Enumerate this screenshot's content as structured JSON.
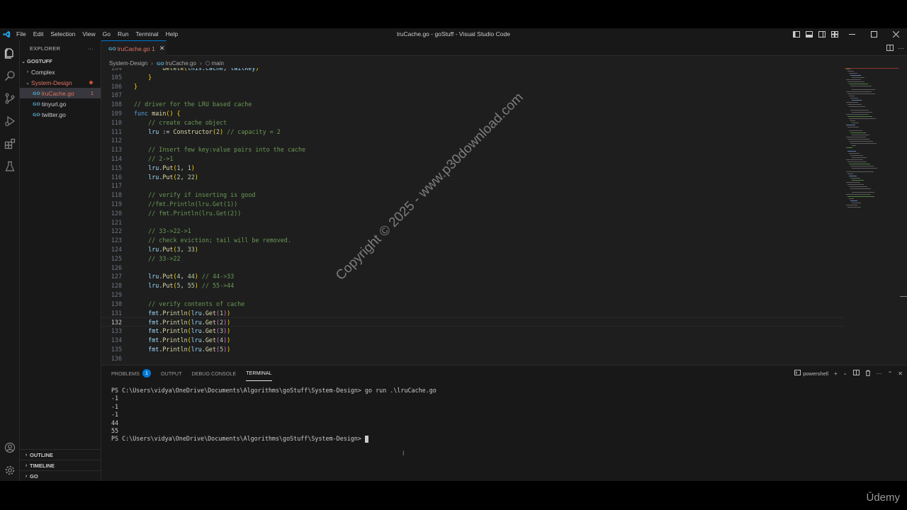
{
  "window": {
    "title": "lruCache.go - goStuff - Visual Studio Code"
  },
  "menu": [
    "File",
    "Edit",
    "Selection",
    "View",
    "Go",
    "Run",
    "Terminal",
    "Help"
  ],
  "sidebar": {
    "title": "EXPLORER",
    "more": "···",
    "root": "GOSTUFF",
    "items": [
      {
        "label": "Complex",
        "type": "folder"
      },
      {
        "label": "System-Design",
        "type": "folder"
      },
      {
        "label": "lruCache.go",
        "type": "file",
        "badge": "1"
      },
      {
        "label": "tinyurl.go",
        "type": "file"
      },
      {
        "label": "twitter.go",
        "type": "file"
      }
    ],
    "bottom": [
      "OUTLINE",
      "TIMELINE",
      "GO"
    ]
  },
  "editor": {
    "tab": {
      "icon": "GO",
      "label": "lruCache.go",
      "badge": "1"
    },
    "breadcrumb": [
      "System-Design",
      "lruCache.go",
      "main"
    ],
    "lines": [
      {
        "n": "104",
        "text": "        delete(this.cache, tailKey)"
      },
      {
        "n": "105",
        "text": "    }"
      },
      {
        "n": "106",
        "text": "}"
      },
      {
        "n": "107",
        "text": ""
      },
      {
        "n": "108",
        "text": "// driver for the LRU based cache"
      },
      {
        "n": "109",
        "text": "func main() {"
      },
      {
        "n": "110",
        "text": "    // create cache object"
      },
      {
        "n": "111",
        "text": "    lru := Constructor(2) // capacity = 2"
      },
      {
        "n": "112",
        "text": ""
      },
      {
        "n": "113",
        "text": "    // Insert few key:value pairs into the cache"
      },
      {
        "n": "114",
        "text": "    // 2->1"
      },
      {
        "n": "115",
        "text": "    lru.Put(1, 1)"
      },
      {
        "n": "116",
        "text": "    lru.Put(2, 22)"
      },
      {
        "n": "117",
        "text": ""
      },
      {
        "n": "118",
        "text": "    // verify if inserting is good"
      },
      {
        "n": "119",
        "text": "    //fmt.Println(lru.Get(1))"
      },
      {
        "n": "120",
        "text": "    // fmt.Println(lru.Get(2))"
      },
      {
        "n": "121",
        "text": ""
      },
      {
        "n": "122",
        "text": "    // 33->22->1"
      },
      {
        "n": "123",
        "text": "    // check eviction; tail will be removed."
      },
      {
        "n": "124",
        "text": "    lru.Put(3, 33)"
      },
      {
        "n": "125",
        "text": "    // 33->22"
      },
      {
        "n": "126",
        "text": ""
      },
      {
        "n": "127",
        "text": "    lru.Put(4, 44) // 44->33"
      },
      {
        "n": "128",
        "text": "    lru.Put(5, 55) // 55->44"
      },
      {
        "n": "129",
        "text": ""
      },
      {
        "n": "130",
        "text": "    // verify contents of cache"
      },
      {
        "n": "131",
        "text": "    fmt.Println(lru.Get(1))"
      },
      {
        "n": "132",
        "text": "    fmt.Println(lru.Get(2))"
      },
      {
        "n": "133",
        "text": "    fmt.Println(lru.Get(3))"
      },
      {
        "n": "134",
        "text": "    fmt.Println(lru.Get(4))"
      },
      {
        "n": "135",
        "text": "    fmt.Println(lru.Get(5))"
      },
      {
        "n": "136",
        "text": ""
      }
    ],
    "current_line": "132"
  },
  "panel": {
    "tabs": [
      "PROBLEMS",
      "OUTPUT",
      "DEBUG CONSOLE",
      "TERMINAL"
    ],
    "problems_count": "1",
    "active_tab": "TERMINAL",
    "shell": "powershell",
    "terminal_lines": [
      "PS C:\\Users\\vidya\\OneDrive\\Documents\\Algorithms\\goStuff\\System-Design> go run .\\lruCache.go",
      "-1",
      "-1",
      "-1",
      "44",
      "55"
    ],
    "prompt": "PS C:\\Users\\vidya\\OneDrive\\Documents\\Algorithms\\goStuff\\System-Design> "
  },
  "watermark": "Copyright © 2025 - www.p30download.com",
  "brand": "Ūdemy",
  "colors": {
    "accent": "#0078d4",
    "error": "#e07464",
    "editor_bg": "#1e1e1e",
    "chrome_bg": "#181818"
  }
}
